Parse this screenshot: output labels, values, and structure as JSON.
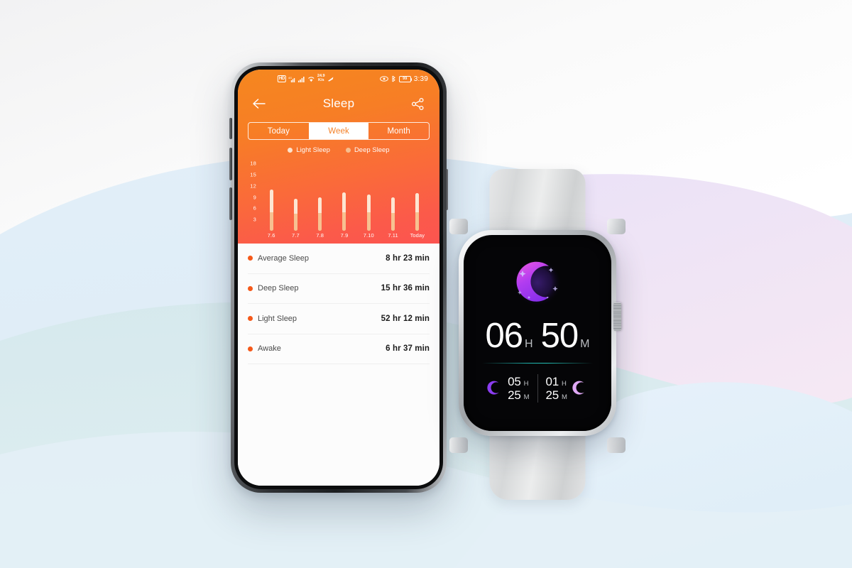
{
  "background": {
    "colors": {
      "top_gradient_start": "#f2f2f3",
      "wave_blue_light": "#e3f0f8",
      "wave_blue_mid": "#d9ebf2",
      "wave_teal": "#d5e9ec",
      "wave_purple": "#eae4f7",
      "wave_pink": "#f6e9f4"
    }
  },
  "phone": {
    "device_name": "smartphone-mockup",
    "statusbar": {
      "icons_left": [
        "hd-badge-icon",
        "signal-4g-icon",
        "signal-bars-icon",
        "wifi-icon",
        "data-rate-icon",
        "network-arrow-icon"
      ],
      "data_rate_value": "24.9",
      "data_rate_unit": "K/s",
      "icons_right": [
        "eye-care-icon",
        "bluetooth-icon",
        "battery-icon"
      ],
      "battery_level": "99",
      "time": "3:39"
    },
    "appbar": {
      "back_icon": "arrow-left-icon",
      "title": "Sleep",
      "share_icon": "share-icon"
    },
    "segment": {
      "options": [
        "Today",
        "Week",
        "Month"
      ],
      "active_index": 1,
      "active_bg": "#ffffff",
      "active_text_color": "#f4822a"
    },
    "legend": [
      {
        "label": "Light Sleep",
        "color": "#fde6d2"
      },
      {
        "label": "Deep Sleep",
        "color": "#f7c191"
      }
    ],
    "stats": {
      "rows": [
        {
          "label": "Average Sleep",
          "value": "8 hr 23 min",
          "dot_color": "#f5591a"
        },
        {
          "label": "Deep Sleep",
          "value": "15 hr 36 min",
          "dot_color": "#f5591a"
        },
        {
          "label": "Light Sleep",
          "value": "52 hr 12 min",
          "dot_color": "#f5591a"
        },
        {
          "label": "Awake",
          "value": "6 hr 37 min",
          "dot_color": "#f5591a"
        }
      ]
    }
  },
  "chart_data": {
    "type": "bar",
    "title": "Sleep",
    "xlabel": "",
    "ylabel": "",
    "ylim": [
      0,
      19
    ],
    "grid": false,
    "legend_position": "top-center",
    "stacked": true,
    "categories": [
      "7.6",
      "7.7",
      "7.8",
      "7.9",
      "7.10",
      "7.11",
      "Today"
    ],
    "yticks": [
      3,
      6,
      9,
      12,
      15,
      18
    ],
    "series": [
      {
        "name": "Deep Sleep",
        "color": "#f7c191",
        "values": [
          5.0,
          4.6,
          4.8,
          5.0,
          4.9,
          4.7,
          5.0
        ]
      },
      {
        "name": "Light Sleep",
        "color": "#fde6d2",
        "values": [
          6.0,
          3.9,
          4.2,
          5.2,
          4.8,
          4.3,
          5.1
        ]
      }
    ],
    "totals": [
      11.0,
      8.5,
      9.0,
      10.2,
      9.7,
      9.0,
      10.1
    ]
  },
  "watch": {
    "device_name": "smartwatch-mockup",
    "face": {
      "sleep_icon": "crescent-moon-icon",
      "total": {
        "hours": "06",
        "hours_unit": "H",
        "minutes": "50",
        "minutes_unit": "M"
      },
      "breakdown": [
        {
          "icon": "moon-deep-icon",
          "icon_color": "#8b3df0",
          "hours": "05",
          "hours_unit": "H",
          "minutes": "25",
          "minutes_unit": "M"
        },
        {
          "icon": "moon-light-icon",
          "icon_color": "#dfa8f5",
          "hours": "01",
          "hours_unit": "H",
          "minutes": "25",
          "minutes_unit": "M"
        }
      ],
      "divider_color": "#24c0b6"
    }
  }
}
